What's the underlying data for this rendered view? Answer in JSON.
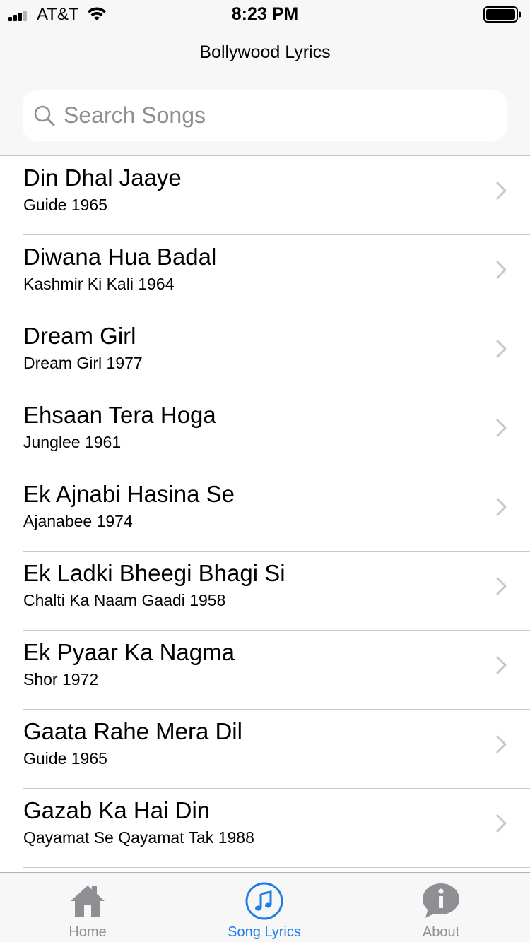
{
  "status_bar": {
    "carrier": "AT&T",
    "time": "8:23 PM"
  },
  "nav": {
    "title": "Bollywood Lyrics"
  },
  "search": {
    "placeholder": "Search Songs",
    "value": ""
  },
  "songs": [
    {
      "title": "Din Dhal Jaaye",
      "subtitle": "Guide 1965"
    },
    {
      "title": "Diwana Hua Badal",
      "subtitle": "Kashmir Ki Kali 1964"
    },
    {
      "title": "Dream Girl",
      "subtitle": "Dream Girl 1977"
    },
    {
      "title": "Ehsaan Tera Hoga",
      "subtitle": "Junglee 1961"
    },
    {
      "title": "Ek Ajnabi Hasina Se",
      "subtitle": "Ajanabee 1974"
    },
    {
      "title": "Ek Ladki Bheegi Bhagi Si",
      "subtitle": "Chalti Ka Naam Gaadi 1958"
    },
    {
      "title": "Ek Pyaar Ka Nagma",
      "subtitle": "Shor 1972"
    },
    {
      "title": "Gaata Rahe Mera Dil",
      "subtitle": "Guide 1965"
    },
    {
      "title": "Gazab Ka Hai Din",
      "subtitle": "Qayamat Se Qayamat Tak 1988"
    }
  ],
  "tabs": [
    {
      "label": "Home",
      "icon": "house-icon",
      "active": false
    },
    {
      "label": "Song Lyrics",
      "icon": "music-note-icon",
      "active": true
    },
    {
      "label": "About",
      "icon": "info-bubble-icon",
      "active": false
    }
  ],
  "colors": {
    "accent": "#1e7ee6",
    "inactive": "#8e8e93",
    "separator": "#c8c7cc",
    "bar_background": "#f7f7f7"
  }
}
